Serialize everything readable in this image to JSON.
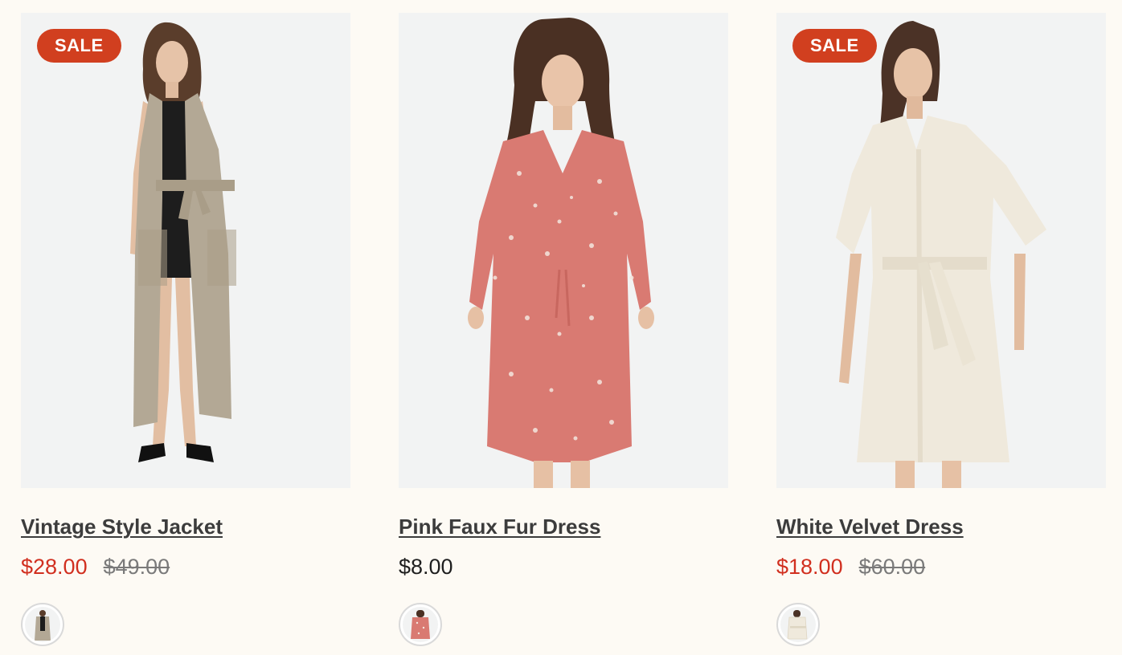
{
  "products": [
    {
      "title": "Vintage Style Jacket",
      "badge": "SALE",
      "price": "$28.00",
      "compare_price": "$49.00",
      "on_sale": true,
      "image_icon": "model-beige-long-vest-photo",
      "swatch_icon": "beige-vest-swatch",
      "garment_color": "#b3a895",
      "accent_color": "#1d1d1d"
    },
    {
      "title": "Pink Faux Fur Dress",
      "badge": "",
      "price": "$8.00",
      "compare_price": "",
      "on_sale": false,
      "image_icon": "model-pink-floral-dress-photo",
      "swatch_icon": "pink-dress-swatch",
      "garment_color": "#d97a72",
      "accent_color": "#f4e7df"
    },
    {
      "title": "White Velvet Dress",
      "badge": "SALE",
      "price": "$18.00",
      "compare_price": "$60.00",
      "on_sale": true,
      "image_icon": "model-white-shirt-dress-photo",
      "swatch_icon": "white-dress-swatch",
      "garment_color": "#efe9dc",
      "accent_color": "#e4dccb"
    }
  ],
  "colors": {
    "badge_bg": "#d13f1f",
    "sale_price": "#d12f1f",
    "compare_price": "#7a7a7a",
    "title": "#3c3c3c",
    "page_bg": "#fdfaf4",
    "image_bg": "#f2f3f3"
  }
}
